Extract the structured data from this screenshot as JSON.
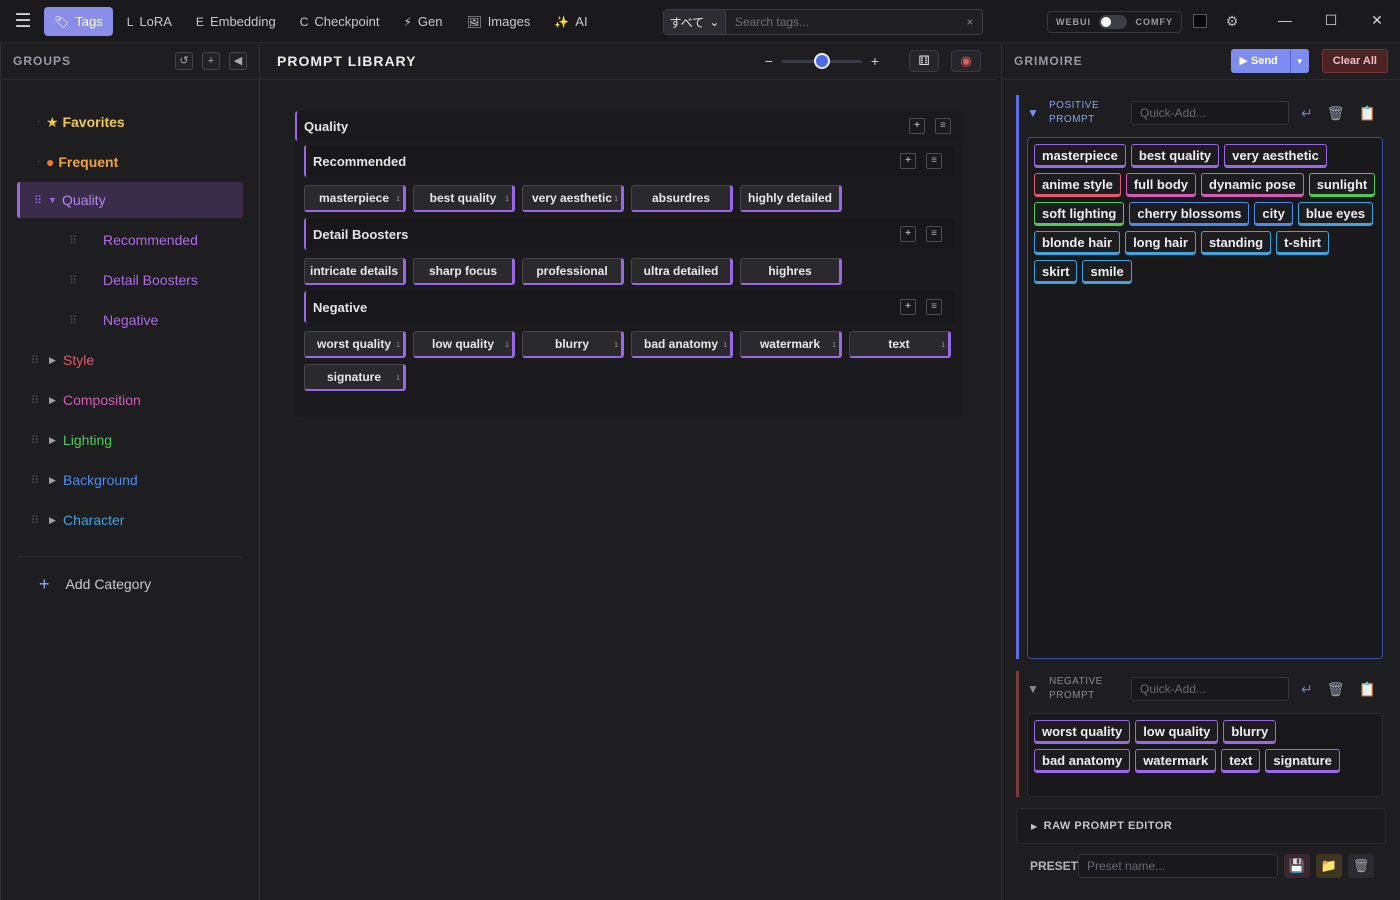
{
  "topbar": {
    "menu_icon": "hamburger-icon",
    "tabs": [
      {
        "label": "Tags",
        "icon": "🏷",
        "active": true
      },
      {
        "label": "LoRA",
        "icon": "L"
      },
      {
        "label": "Embedding",
        "icon": "E"
      },
      {
        "label": "Checkpoint",
        "icon": "C"
      },
      {
        "label": "Gen",
        "icon": "⚡"
      },
      {
        "label": "Images",
        "icon": "🖼"
      },
      {
        "label": "AI",
        "icon": "✨"
      }
    ],
    "search": {
      "scope": "すべて",
      "placeholder": "Search tags...",
      "clear": "×"
    },
    "mode": {
      "left": "WEBUI",
      "right": "COMFY"
    },
    "window": {
      "minimize": "—",
      "maximize": "☐",
      "close": "✕"
    }
  },
  "groups": {
    "title": "GROUPS",
    "buttons": {
      "refresh": "↺",
      "add": "+",
      "collapse": "◀"
    },
    "favorites": "Favorites",
    "frequent": "Frequent",
    "selected": "Quality",
    "quality_children": [
      "Recommended",
      "Detail Boosters",
      "Negative"
    ],
    "categories": [
      {
        "label": "Style",
        "color": "#e15a6e"
      },
      {
        "label": "Composition",
        "color": "#d45cb8"
      },
      {
        "label": "Lighting",
        "color": "#4ecb5a"
      },
      {
        "label": "Background",
        "color": "#4b8bf0"
      },
      {
        "label": "Character",
        "color": "#3fa3e0"
      }
    ],
    "add_category": "Add Category"
  },
  "library": {
    "title": "PROMPT LIBRARY",
    "zoom_minus": "−",
    "zoom_plus": "+",
    "zoom_level": 0.5,
    "group": "Quality",
    "subgroups": [
      {
        "name": "Recommended",
        "tags": [
          {
            "label": "masterpiece",
            "count": "1"
          },
          {
            "label": "best quality",
            "count": "1"
          },
          {
            "label": "very aesthetic",
            "count": "1"
          },
          {
            "label": "absurdres",
            "count": ""
          },
          {
            "label": "highly detailed",
            "count": ""
          }
        ]
      },
      {
        "name": "Detail Boosters",
        "tags": [
          {
            "label": "intricate details",
            "count": ""
          },
          {
            "label": "sharp focus",
            "count": ""
          },
          {
            "label": "professional",
            "count": ""
          },
          {
            "label": "ultra detailed",
            "count": ""
          },
          {
            "label": "highres",
            "count": ""
          }
        ]
      },
      {
        "name": "Negative",
        "tags": [
          {
            "label": "worst quality",
            "count": "1"
          },
          {
            "label": "low quality",
            "count": "1"
          },
          {
            "label": "blurry",
            "count": "1"
          },
          {
            "label": "bad anatomy",
            "count": "1"
          },
          {
            "label": "watermark",
            "count": "1"
          },
          {
            "label": "text",
            "count": "1"
          },
          {
            "label": "signature",
            "count": "1"
          }
        ]
      }
    ]
  },
  "grimoire": {
    "title": "GRIMOIRE",
    "send": "Send",
    "clear": "Clear All",
    "positive": {
      "label_1": "POSITIVE",
      "label_2": "PROMPT",
      "placeholder": "Quick-Add...",
      "tags": [
        {
          "label": "masterpiece",
          "color": "#9a68e6"
        },
        {
          "label": "best quality",
          "color": "#9a68e6"
        },
        {
          "label": "very aesthetic",
          "color": "#9a68e6"
        },
        {
          "label": "anime style",
          "color": "#e15a6e"
        },
        {
          "label": "full body",
          "color": "#d45cb8"
        },
        {
          "label": "dynamic pose",
          "color": "#d45cb8"
        },
        {
          "label": "sunlight",
          "color": "#4ecb5a"
        },
        {
          "label": "soft lighting",
          "color": "#4ecb5a"
        },
        {
          "label": "cherry blossoms",
          "color": "#4b8bf0"
        },
        {
          "label": "city",
          "color": "#4b8bf0"
        },
        {
          "label": "blue eyes",
          "color": "#3fa3e0"
        },
        {
          "label": "blonde hair",
          "color": "#3fa3e0"
        },
        {
          "label": "long hair",
          "color": "#3fa3e0"
        },
        {
          "label": "standing",
          "color": "#3fa3e0"
        },
        {
          "label": "t-shirt",
          "color": "#3fa3e0"
        },
        {
          "label": "skirt",
          "color": "#3fa3e0"
        },
        {
          "label": "smile",
          "color": "#3fa3e0"
        }
      ]
    },
    "negative": {
      "label_1": "NEGATIVE",
      "label_2": "PROMPT",
      "placeholder": "Quick-Add...",
      "tags": [
        {
          "label": "worst quality"
        },
        {
          "label": "low quality"
        },
        {
          "label": "blurry"
        },
        {
          "label": "bad anatomy"
        },
        {
          "label": "watermark"
        },
        {
          "label": "text"
        },
        {
          "label": "signature"
        }
      ]
    },
    "raw_editor": "RAW PROMPT EDITOR",
    "preset_label": "PRESET",
    "preset_placeholder": "Preset name..."
  }
}
